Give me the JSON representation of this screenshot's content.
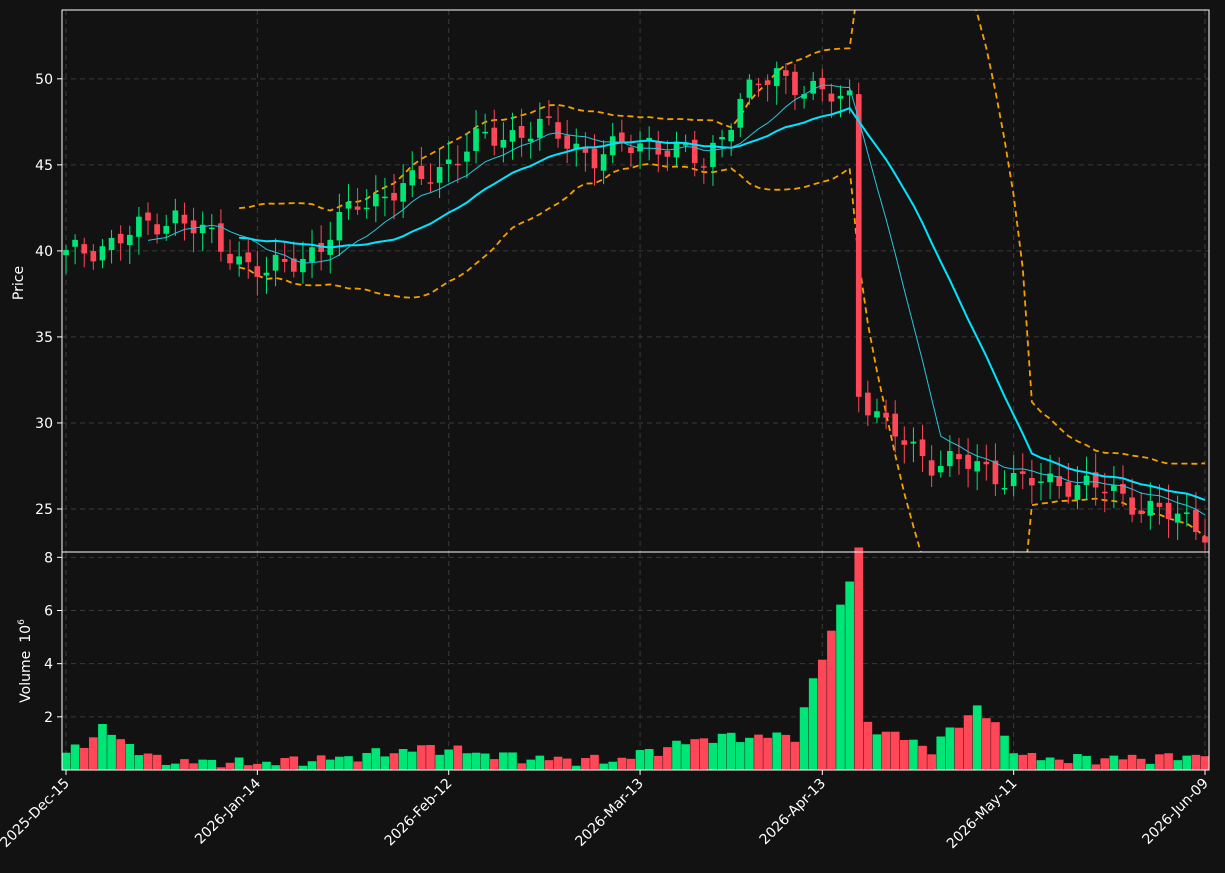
{
  "chart_data": [
    {
      "type": "candlestick",
      "panel": "price",
      "ylabel": "Price",
      "ylim": [
        22.5,
        54
      ],
      "y_ticks": [
        25,
        30,
        35,
        40,
        45,
        50
      ],
      "x_tick_labels": [
        "2025-Dec-15",
        "2026-Jan-14",
        "2026-Feb-12",
        "2026-Mar-13",
        "2026-Apr-13",
        "2026-May-11",
        "2026-Jun-09"
      ],
      "grid": true,
      "num_bars": 126,
      "ohlc_keyframes": [
        {
          "i": 0,
          "close": 39.7
        },
        {
          "i": 5,
          "close": 40.5
        },
        {
          "i": 12,
          "close": 42.1
        },
        {
          "i": 16,
          "close": 40.6
        },
        {
          "i": 22,
          "close": 38.6
        },
        {
          "i": 28,
          "close": 40.3
        },
        {
          "i": 32,
          "close": 42.8
        },
        {
          "i": 38,
          "close": 43.8
        },
        {
          "i": 45,
          "close": 46.3
        },
        {
          "i": 52,
          "close": 47.2
        },
        {
          "i": 58,
          "close": 45.5
        },
        {
          "i": 64,
          "close": 46.4
        },
        {
          "i": 70,
          "close": 45.1
        },
        {
          "i": 74,
          "close": 48.7
        },
        {
          "i": 78,
          "close": 50.4
        },
        {
          "i": 83,
          "close": 48.9
        },
        {
          "i": 86,
          "close": 49.0
        },
        {
          "i": 87,
          "close": 32.0
        },
        {
          "i": 90,
          "close": 29.6
        },
        {
          "i": 95,
          "close": 27.8
        },
        {
          "i": 100,
          "close": 27.5
        },
        {
          "i": 105,
          "close": 26.5
        },
        {
          "i": 110,
          "close": 26.6
        },
        {
          "i": 115,
          "close": 25.9
        },
        {
          "i": 120,
          "close": 24.8
        },
        {
          "i": 125,
          "close": 23.9
        }
      ],
      "moving_averages": [
        {
          "name": "",
          "color": "#00e5ff",
          "period": 20
        },
        {
          "name": "",
          "color": "#26c6da",
          "period": 10
        }
      ],
      "bands": {
        "name": "",
        "color": "#f5a000",
        "style": "dashed"
      },
      "colors": {
        "up": "#00e676",
        "down": "#ff4757",
        "background": "#121212",
        "text": "#ffffff",
        "grid": "#3a3a3a"
      }
    },
    {
      "type": "bar",
      "panel": "volume",
      "ylabel": "Volume",
      "ylabel_exponent": "10",
      "ylabel_exponent_power": "6",
      "ylim": [
        0,
        8.2
      ],
      "y_ticks": [
        2,
        4,
        6,
        8
      ],
      "grid": true,
      "volume_keyframes_millions": [
        {
          "i": 0,
          "v": 0.55
        },
        {
          "i": 4,
          "v": 1.55
        },
        {
          "i": 10,
          "v": 0.35
        },
        {
          "i": 20,
          "v": 0.25
        },
        {
          "i": 30,
          "v": 0.45
        },
        {
          "i": 40,
          "v": 0.85
        },
        {
          "i": 50,
          "v": 0.45
        },
        {
          "i": 60,
          "v": 0.35
        },
        {
          "i": 70,
          "v": 1.2
        },
        {
          "i": 80,
          "v": 1.3
        },
        {
          "i": 87,
          "v": 8.2
        },
        {
          "i": 88,
          "v": 1.7
        },
        {
          "i": 95,
          "v": 0.8
        },
        {
          "i": 100,
          "v": 2.4
        },
        {
          "i": 105,
          "v": 0.5
        },
        {
          "i": 110,
          "v": 0.4
        },
        {
          "i": 115,
          "v": 0.45
        },
        {
          "i": 120,
          "v": 0.45
        },
        {
          "i": 125,
          "v": 0.6
        }
      ]
    }
  ]
}
